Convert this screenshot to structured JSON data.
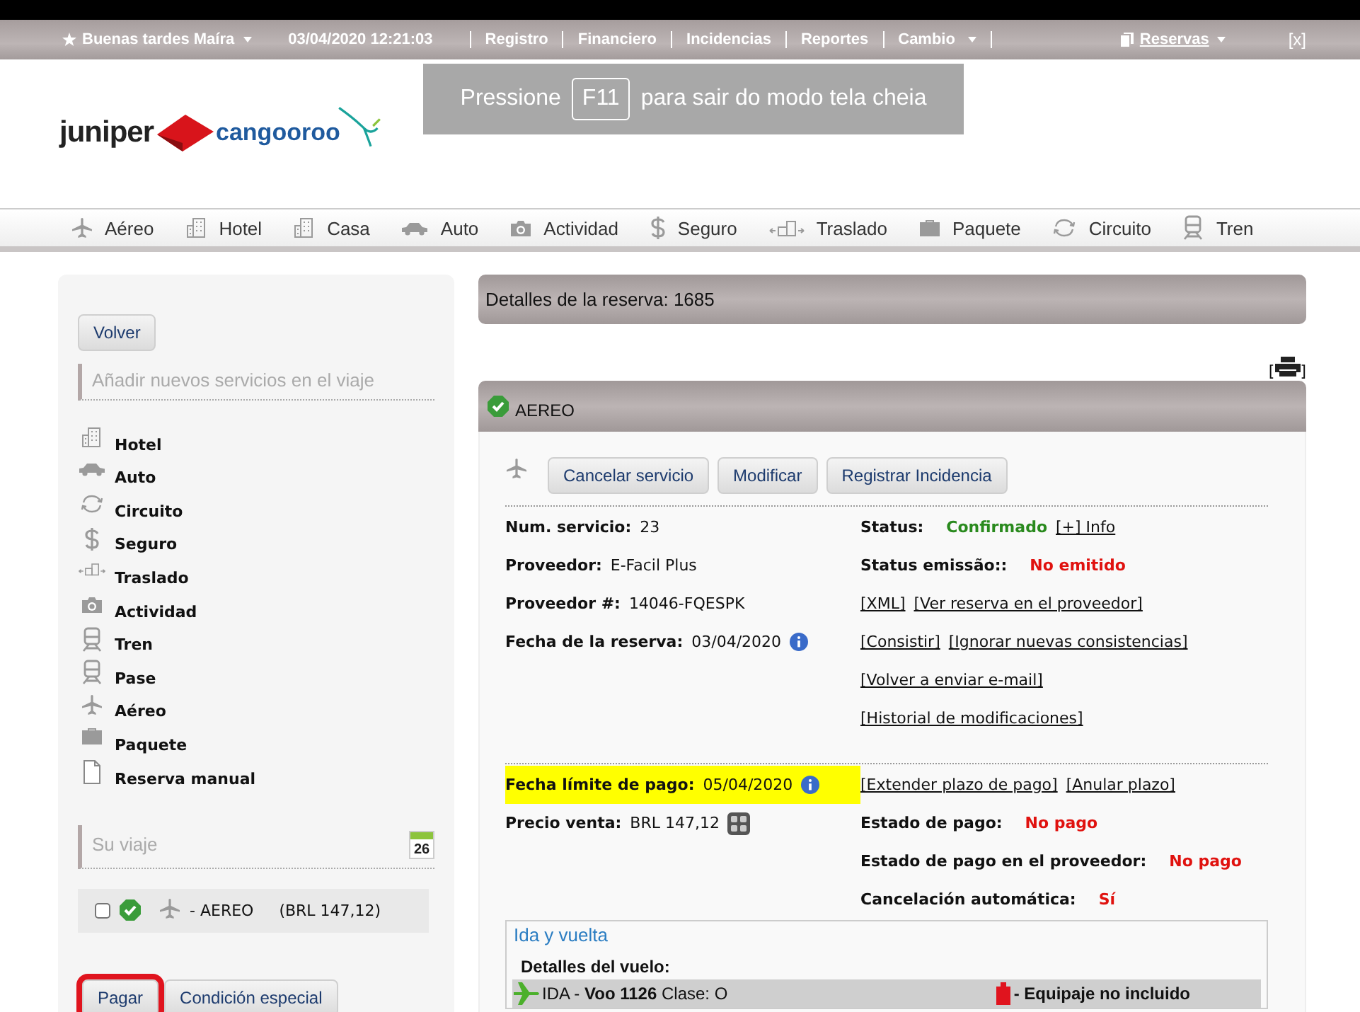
{
  "top_bar": {
    "greeting": "Buenas tardes Maíra",
    "datetime": "03/04/2020 12:21:03",
    "menu": [
      {
        "label": "Registro",
        "dropdown": false
      },
      {
        "label": "Financiero",
        "dropdown": false
      },
      {
        "label": "Incidencias",
        "dropdown": false
      },
      {
        "label": "Reportes",
        "dropdown": false
      },
      {
        "label": "Cambio",
        "dropdown": true
      }
    ],
    "reservas": {
      "label": "Reservas",
      "dropdown": true
    },
    "close": "[x]"
  },
  "fullscreen_notice": {
    "before": "Pressione",
    "key": "F11",
    "after": "para sair do modo tela cheia"
  },
  "logo": {
    "brand": "juniper",
    "partner": "cangooroo"
  },
  "services_bar": [
    "Aéreo",
    "Hotel",
    "Casa",
    "Auto",
    "Actividad",
    "Seguro",
    "Traslado",
    "Paquete",
    "Circuito",
    "Tren"
  ],
  "sidebar": {
    "back_button": "Volver",
    "add_title": "Añadir nuevos servicios en el viaje",
    "add_items": [
      "Hotel",
      "Auto",
      "Circuito",
      "Seguro",
      "Traslado",
      "Actividad",
      "Tren",
      "Pase",
      "Aéreo",
      "Paquete",
      "Reserva manual"
    ],
    "trip_title": "Su viaje",
    "calendar_day": "26",
    "trip_items": [
      {
        "checked": false,
        "confirmed": true,
        "name": "- AEREO",
        "price": "(BRL 147,12)"
      }
    ],
    "buttons": [
      {
        "label": "Pagar",
        "highlighted": true
      },
      {
        "label": "Condición especial",
        "highlighted": false
      }
    ]
  },
  "booking": {
    "title": "Detalles de la reserva: 1685",
    "print_brackets": [
      "[",
      "]"
    ]
  },
  "service": {
    "title": "AEREO",
    "confirmed": true,
    "actions": [
      "Cancelar servicio",
      "Modificar",
      "Registrar Incidencia"
    ],
    "details_left": [
      {
        "kind": "plain",
        "label": "Num. servicio:",
        "value": "23"
      },
      {
        "kind": "plain",
        "label": "Proveedor:",
        "value": "E-Facil Plus"
      },
      {
        "kind": "plain",
        "label": "Proveedor #:",
        "value": "14046-FQESPK"
      },
      {
        "kind": "info",
        "label": "Fecha de la reserva:",
        "value": "03/04/2020"
      }
    ],
    "details_right": [
      {
        "kind": "field",
        "label": "Status:",
        "value": "Confirmado",
        "color": "#2a8a1e",
        "links": [
          "[+] Info"
        ]
      },
      {
        "kind": "field",
        "label": "Status emissão::",
        "value": "No emitido",
        "color": "#e0120f"
      },
      {
        "kind": "links",
        "links": [
          "[XML]",
          "[Ver reserva en el proveedor]"
        ]
      },
      {
        "kind": "links",
        "links": [
          "[Consistir]",
          "[Ignorar nuevas consistencias]"
        ]
      },
      {
        "kind": "links",
        "links": [
          "[Volver a enviar e-mail]"
        ]
      },
      {
        "kind": "links",
        "links": [
          "[Historial de modificaciones]"
        ]
      }
    ],
    "payment_left": [
      {
        "kind": "info",
        "label": "Fecha límite de pago:",
        "value": "05/04/2020",
        "highlighted": true
      },
      {
        "kind": "calculator",
        "label": "Precio venta:",
        "value": "BRL 147,12",
        "highlighted": false
      }
    ],
    "payment_right": [
      {
        "kind": "links",
        "links": [
          "[Extender plazo de pago]",
          "[Anular plazo]"
        ]
      },
      {
        "kind": "field",
        "label": "Estado de pago:",
        "value": "No pago",
        "color": "#e0120f"
      },
      {
        "kind": "field",
        "label": "Estado de pago en el proveedor:",
        "value": "No pago",
        "color": "#e0120f"
      },
      {
        "kind": "field",
        "label": "Cancelación automática:",
        "value": "Sí",
        "color": "#e0120f"
      }
    ]
  },
  "flight": {
    "title": "Ida y vuelta",
    "subtitle": "Detalles del vuelo:",
    "segment": "IDA - **Voo 1126** Clase: O",
    "baggage": "- Equipaje no incluido"
  }
}
